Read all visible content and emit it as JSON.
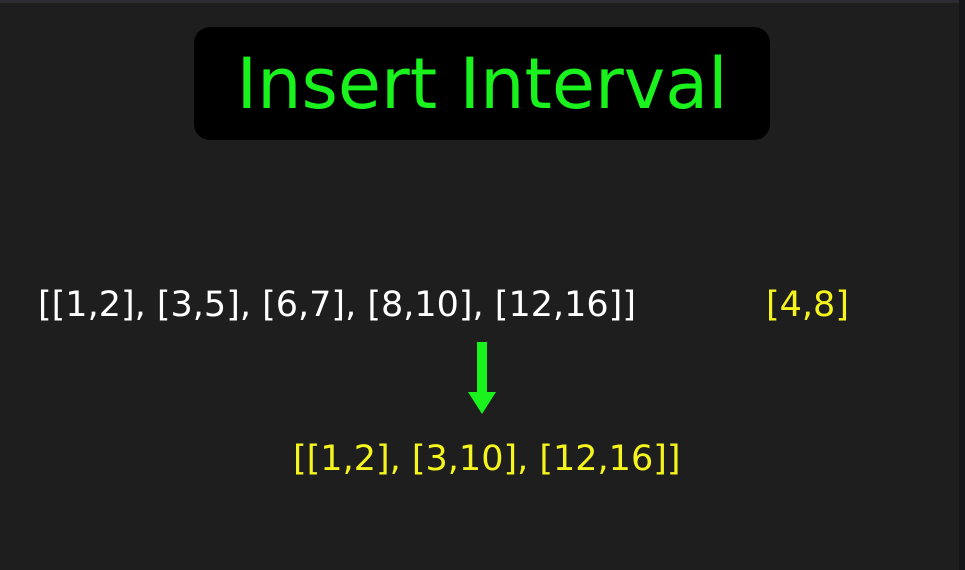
{
  "title": "Insert Interval",
  "intervals_text": "[[1,2], [3,5], [6,7], [8,10], [12,16]]",
  "new_interval_text": "[4,8]",
  "result_text": "[[1,2], [3,10], [12,16]]",
  "colors": {
    "background": "#1e1e1e",
    "title_box": "#000000",
    "title_text": "#19f21d",
    "arrow": "#19f21d",
    "intervals_text": "#ffffff",
    "highlight_text": "#f5f51d"
  },
  "icons": {
    "arrow": "arrow-down-icon"
  }
}
